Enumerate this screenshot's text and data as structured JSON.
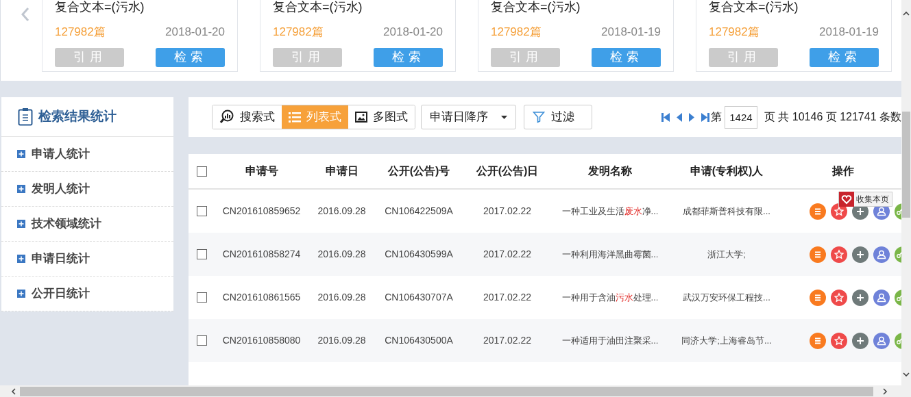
{
  "carousel": {
    "cards": [
      {
        "title": "复合文本=(污水)",
        "count": "127982篇",
        "date": "2018-01-20",
        "cite_button": "引用",
        "search_button": "检索"
      },
      {
        "title": "复合文本=(污水)",
        "count": "127982篇",
        "date": "2018-01-20",
        "cite_button": "引用",
        "search_button": "检索"
      },
      {
        "title": "复合文本=(污水)",
        "count": "127982篇",
        "date": "2018-01-19",
        "cite_button": "引用",
        "search_button": "检索"
      },
      {
        "title": "复合文本=(污水)",
        "count": "127982篇",
        "date": "2018-01-19",
        "cite_button": "引用",
        "search_button": "检索"
      }
    ]
  },
  "sidebar": {
    "title": "检索结果统计",
    "items": [
      {
        "label": "申请人统计",
        "expanded": false
      },
      {
        "label": "发明人统计",
        "expanded": false
      },
      {
        "label": "技术领域统计",
        "expanded": false
      },
      {
        "label": "申请日统计",
        "expanded": false
      },
      {
        "label": "公开日统计",
        "expanded": false
      }
    ]
  },
  "toolbar": {
    "views": [
      {
        "label": "搜索式",
        "kind": "search",
        "selected": false
      },
      {
        "label": "列表式",
        "kind": "list",
        "selected": true
      },
      {
        "label": "多图式",
        "kind": "image",
        "selected": false
      }
    ],
    "sort": {
      "value": "申请日降序"
    },
    "filter_button": "过滤",
    "pagination": {
      "prefix": "第",
      "page": "1424",
      "summary": "页 共 10146 页 121741 条数"
    }
  },
  "table": {
    "select_all": {
      "checked": false
    },
    "columns": [
      "申请号",
      "申请日",
      "公开(公告)号",
      "公开(公告)日",
      "发明名称",
      "申请(专利权)人",
      "操作"
    ],
    "rows": [
      {
        "checked": false,
        "application_no": "CN201610859652",
        "application_date": "2016.09.28",
        "publication_no": "CN106422509A",
        "publication_date": "2017.02.22",
        "title": [
          {
            "text": "一种工业及生活",
            "highlight": false
          },
          {
            "text": "废水",
            "highlight": true
          },
          {
            "text": "净...",
            "highlight": false
          }
        ],
        "applicant": "成都菲斯普科技有限..."
      },
      {
        "checked": false,
        "application_no": "CN201610858274",
        "application_date": "2016.09.28",
        "publication_no": "CN106430599A",
        "publication_date": "2017.02.22",
        "title": [
          {
            "text": "一种利用海洋黑曲霉菌...",
            "highlight": false
          }
        ],
        "applicant": "浙江大学;"
      },
      {
        "checked": false,
        "application_no": "CN201610861565",
        "application_date": "2016.09.28",
        "publication_no": "CN106430707A",
        "publication_date": "2017.02.22",
        "title": [
          {
            "text": "一种用于含油",
            "highlight": false
          },
          {
            "text": "污水",
            "highlight": true
          },
          {
            "text": "处理...",
            "highlight": false
          }
        ],
        "applicant": "武汉万安环保工程技..."
      },
      {
        "checked": false,
        "application_no": "CN201610858080",
        "application_date": "2016.09.28",
        "publication_no": "CN106430500A",
        "publication_date": "2017.02.22",
        "title": [
          {
            "text": "一种适用于油田注聚采...",
            "highlight": false
          }
        ],
        "applicant": "同济大学;上海睿岛节..."
      }
    ]
  },
  "tooltip": {
    "text": "收集本页"
  }
}
